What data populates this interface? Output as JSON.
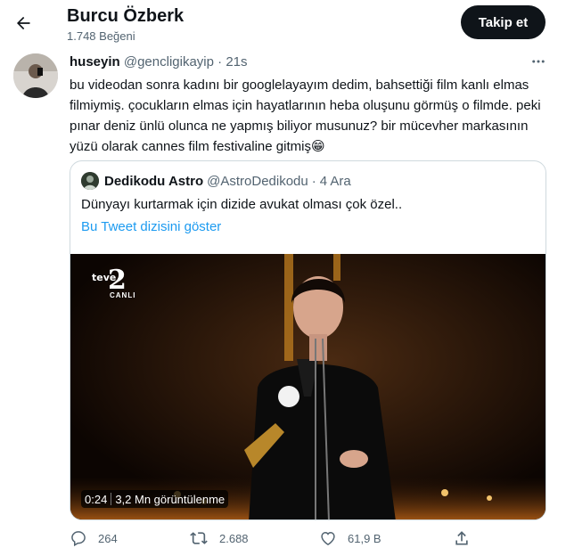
{
  "header": {
    "back_icon": "arrow-left-icon",
    "profile_name": "Burcu Özberk",
    "likes_count": "1.748 Beğeni",
    "follow_label": "Takip et"
  },
  "tweet": {
    "author_name": "huseyin",
    "author_handle": "@gencligikayip",
    "time": "21s",
    "separator": "·",
    "text": "bu videodan sonra kadını bir googlelayayım dedim, bahsettiği film kanlı elmas filmiymiş. çocukların elmas için hayatlarının heba oluşunu görmüş o filmde. peki pınar deniz ünlü olunca ne yapmış biliyor musunuz? bir mücevher markasının yüzü olarak cannes film festivaline gitmiş",
    "emoji": "😁",
    "more_icon": "more-horizontal-icon"
  },
  "quote": {
    "author_name": "Dedikodu Astro",
    "author_handle": "@AstroDedikodu",
    "time": "4 Ara",
    "separator": "·",
    "text": "Dünyayı kurtarmak için dizide avukat olması çok özel..",
    "thread_link": "Bu Tweet dizisini göster",
    "video": {
      "duration": "0:24",
      "views": "3,2 Mn görüntülenme",
      "logo_text": "teve",
      "logo_number": "2",
      "logo_live": "CANLI"
    }
  },
  "actions": {
    "reply_count": "264",
    "retweet_count": "2.688",
    "like_count": "61,9 B",
    "icons": [
      "reply-icon",
      "retweet-icon",
      "like-icon",
      "share-icon"
    ]
  },
  "colors": {
    "accent": "#1d9bf0",
    "text": "#0f1419",
    "muted": "#536471",
    "border": "#cfd9de"
  }
}
